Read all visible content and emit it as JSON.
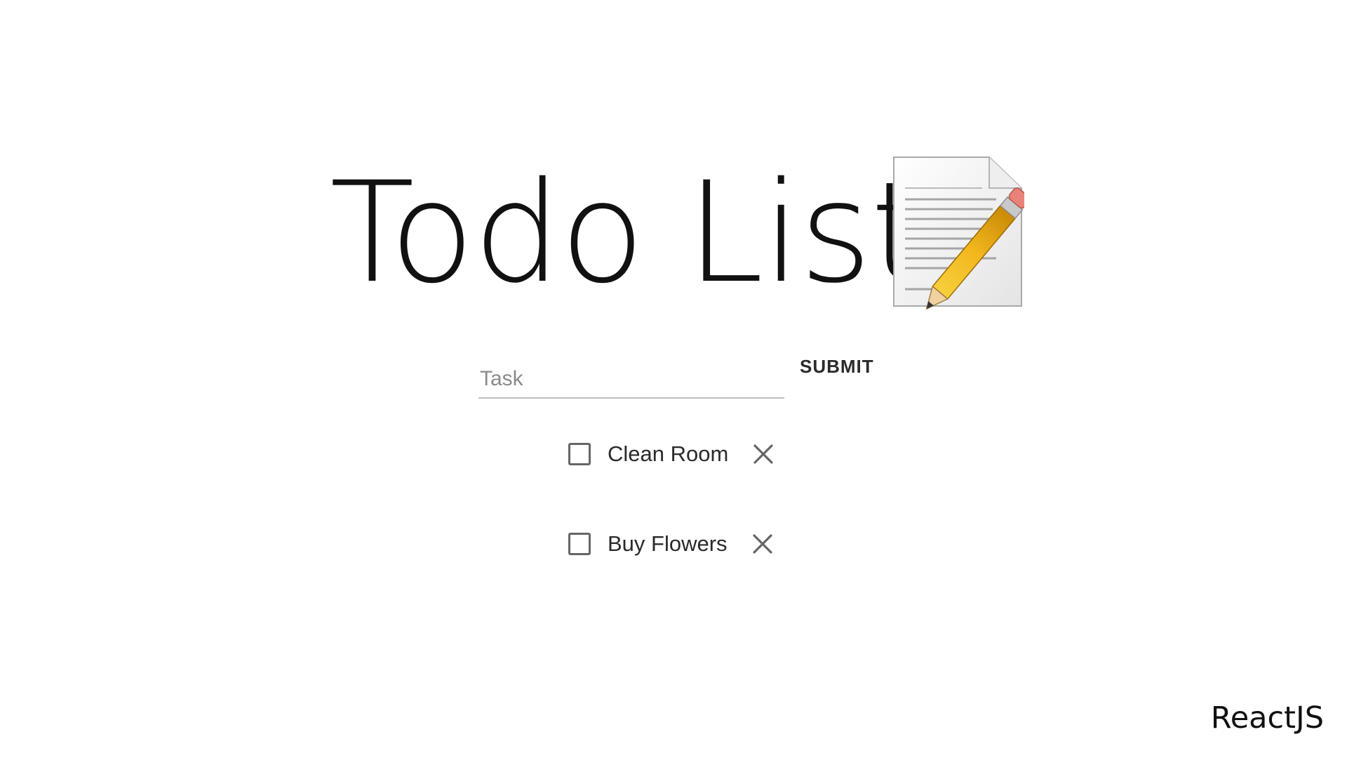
{
  "header": {
    "title": "Todo List",
    "icon": "text-editor-pencil-icon"
  },
  "form": {
    "placeholder": "Task",
    "value": "",
    "submit_label": "SUBMIT"
  },
  "todos": [
    {
      "label": "Clean Room",
      "checked": false
    },
    {
      "label": "Buy Flowers",
      "checked": false
    }
  ],
  "footer": {
    "tag": "ReactJS"
  },
  "colors": {
    "background": "#ffffff",
    "text": "#111111",
    "placeholder": "#8a8a8a",
    "underline": "#bdbdbd",
    "icon_gray": "#666666",
    "pencil_yellow": "#f2b81d"
  }
}
